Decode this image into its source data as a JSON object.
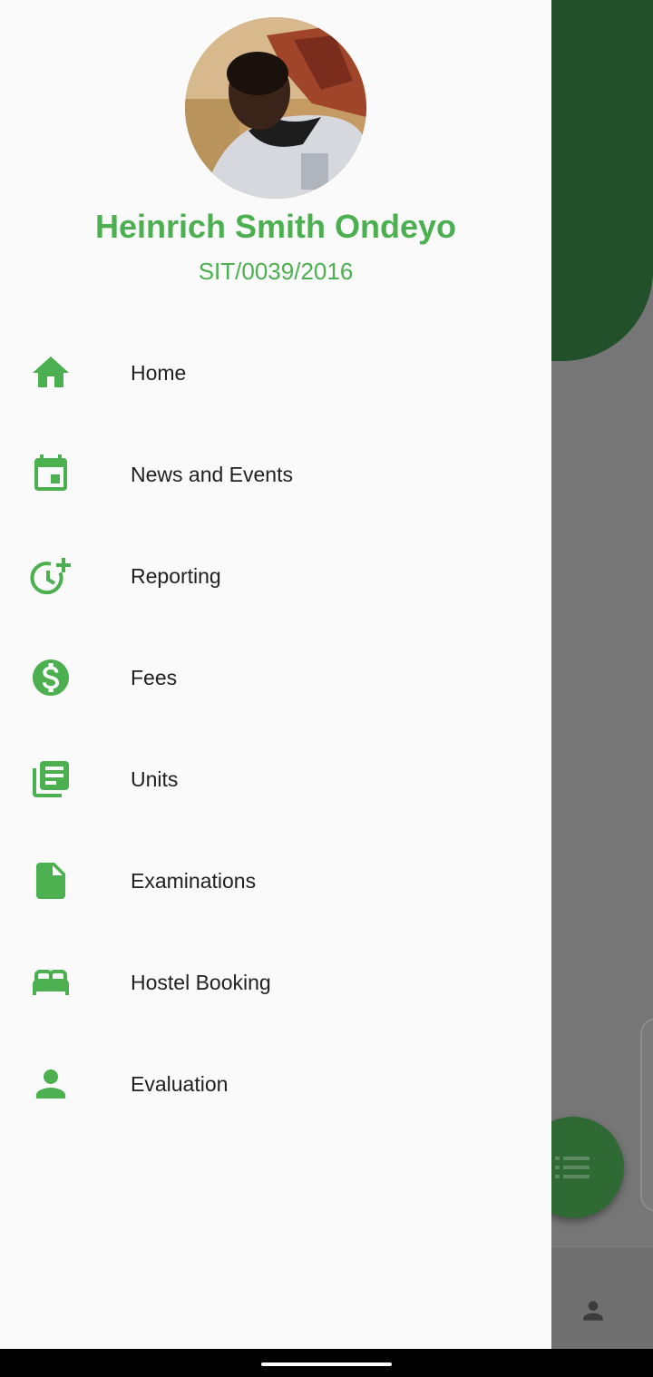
{
  "user": {
    "name": "Heinrich Smith Ondeyo",
    "reg_no": "SIT/0039/2016"
  },
  "menu": {
    "items": [
      {
        "label": "Home",
        "icon": "home-icon"
      },
      {
        "label": "News and Events",
        "icon": "event-icon"
      },
      {
        "label": "Reporting",
        "icon": "clock-plus-icon"
      },
      {
        "label": "Fees",
        "icon": "dollar-circle-icon"
      },
      {
        "label": "Units",
        "icon": "library-books-icon"
      },
      {
        "label": "Examinations",
        "icon": "document-icon"
      },
      {
        "label": "Hostel Booking",
        "icon": "bed-icon"
      },
      {
        "label": "Evaluation",
        "icon": "person-icon"
      }
    ]
  },
  "colors": {
    "accent": "#4caf50",
    "text": "#212121",
    "drawer_bg": "#fafafa",
    "scrim": "#767676",
    "header_dim": "#22502a"
  }
}
